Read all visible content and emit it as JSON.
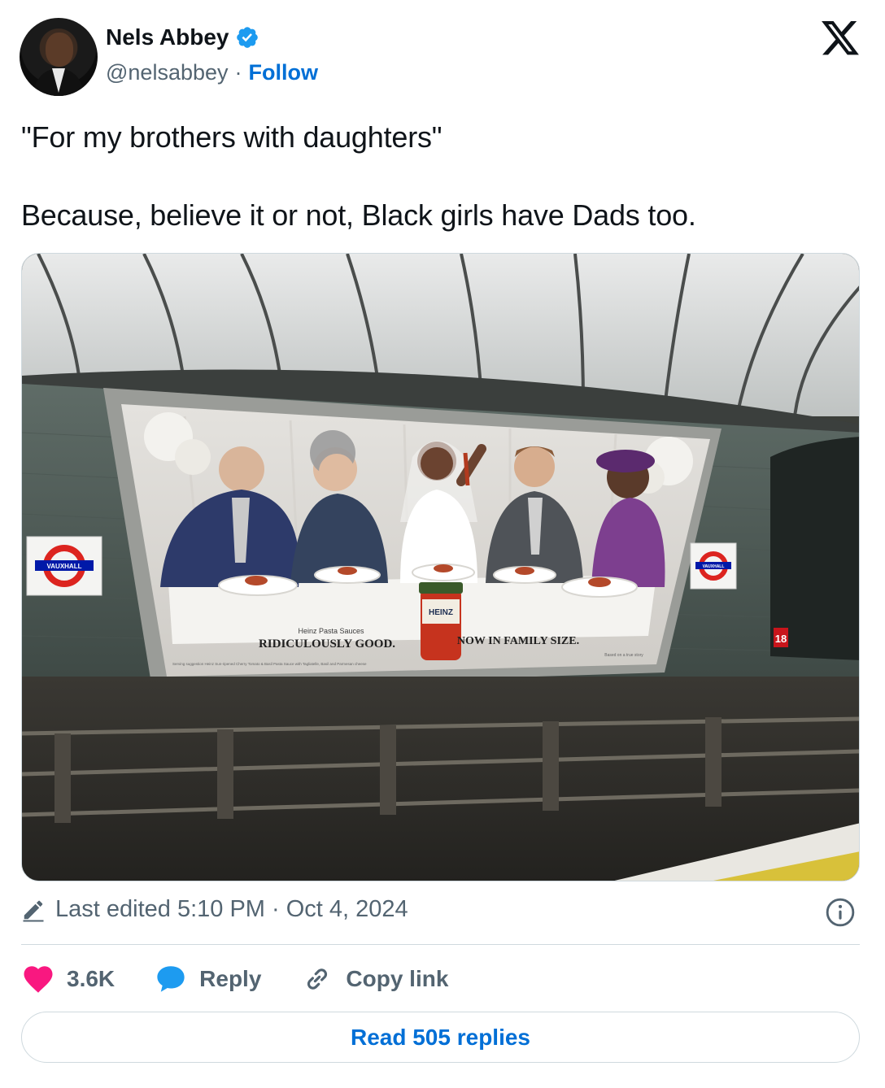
{
  "author": {
    "display_name": "Nels Abbey",
    "handle": "@nelsabbey",
    "separator": "·",
    "follow_label": "Follow"
  },
  "tweet": {
    "line1": "\"For my brothers with daughters\"",
    "line2": "Because, believe it or not, Black girls have Dads too."
  },
  "photo": {
    "station_sign": "VAUXHALL",
    "ad_brand_line": "Heinz Pasta Sauces",
    "ad_tagline": "RIDICULOUSLY GOOD.",
    "ad_family": "NOW IN FAMILY SIZE.",
    "jar_label": "HEINZ",
    "age_rating": "18",
    "ad_small_left": "Serving suggestion Heinz Sun-ripened Cherry Tomato & Basil Pasta Sauce with Tagliatelle, Basil and Parmesan cheese",
    "ad_small_right": "Based on a true story"
  },
  "meta": {
    "edited": "Last edited 5:10 PM · Oct 4, 2024"
  },
  "actions": {
    "likes": "3.6K",
    "reply": "Reply",
    "copy_link": "Copy link"
  },
  "read_replies": "Read 505 replies",
  "colors": {
    "accent": "#006fd6",
    "like": "#f91880",
    "verified": "#1d9bf0",
    "muted": "#536471"
  }
}
